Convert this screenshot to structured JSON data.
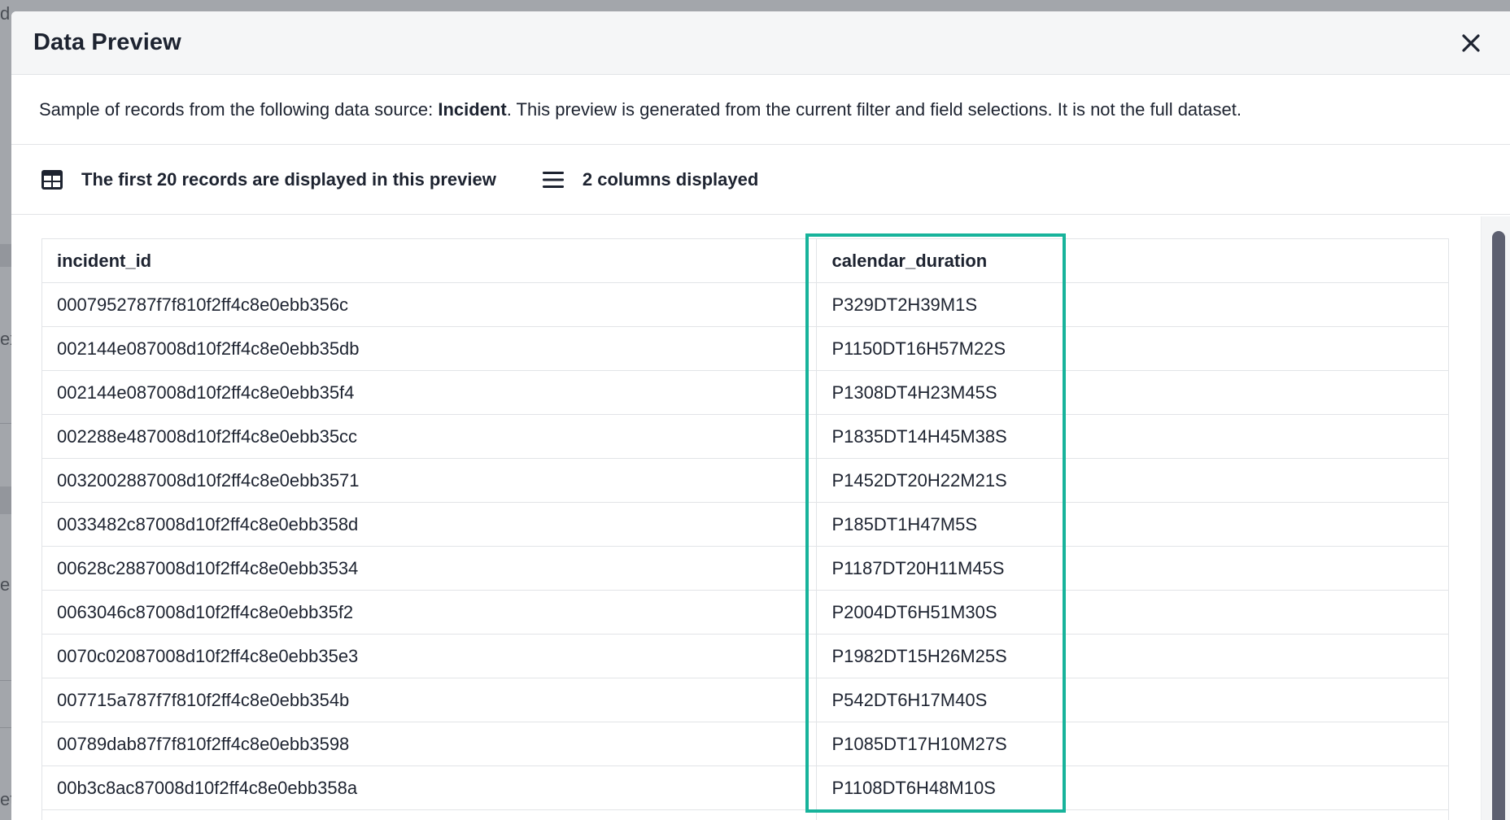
{
  "background": {
    "fragments": [
      "d",
      "ex",
      "e",
      "et"
    ]
  },
  "modal": {
    "title": "Data Preview",
    "close_icon": "close-icon"
  },
  "description": {
    "prefix": "Sample of records from the following data source: ",
    "source": "Incident",
    "suffix": ". This preview is generated from the current filter and field selections. It is not the full dataset."
  },
  "info": {
    "records_icon": "table-grid-icon",
    "records_text": "The first 20 records are displayed in this preview",
    "columns_icon": "list-icon",
    "columns_text": "2 columns displayed"
  },
  "table": {
    "columns": [
      "incident_id",
      "calendar_duration"
    ],
    "rows": [
      [
        "0007952787f7f810f2ff4c8e0ebb356c",
        "P329DT2H39M1S"
      ],
      [
        "002144e087008d10f2ff4c8e0ebb35db",
        "P1150DT16H57M22S"
      ],
      [
        "002144e087008d10f2ff4c8e0ebb35f4",
        "P1308DT4H23M45S"
      ],
      [
        "002288e487008d10f2ff4c8e0ebb35cc",
        "P1835DT14H45M38S"
      ],
      [
        "0032002887008d10f2ff4c8e0ebb3571",
        "P1452DT20H22M21S"
      ],
      [
        "0033482c87008d10f2ff4c8e0ebb358d",
        "P185DT1H47M5S"
      ],
      [
        "00628c2887008d10f2ff4c8e0ebb3534",
        "P1187DT20H11M45S"
      ],
      [
        "0063046c87008d10f2ff4c8e0ebb35f2",
        "P2004DT6H51M30S"
      ],
      [
        "0070c02087008d10f2ff4c8e0ebb35e3",
        "P1982DT15H26M25S"
      ],
      [
        "007715a787f7f810f2ff4c8e0ebb354b",
        "P542DT6H17M40S"
      ],
      [
        "00789dab87f7f810f2ff4c8e0ebb3598",
        "P1085DT17H10M27S"
      ],
      [
        "00b3c8ac87008d10f2ff4c8e0ebb358a",
        "P1108DT6H48M10S"
      ],
      [
        "",
        ""
      ]
    ]
  },
  "colors": {
    "highlight": "#17b39b",
    "scroll_thumb": "#5d6070"
  }
}
